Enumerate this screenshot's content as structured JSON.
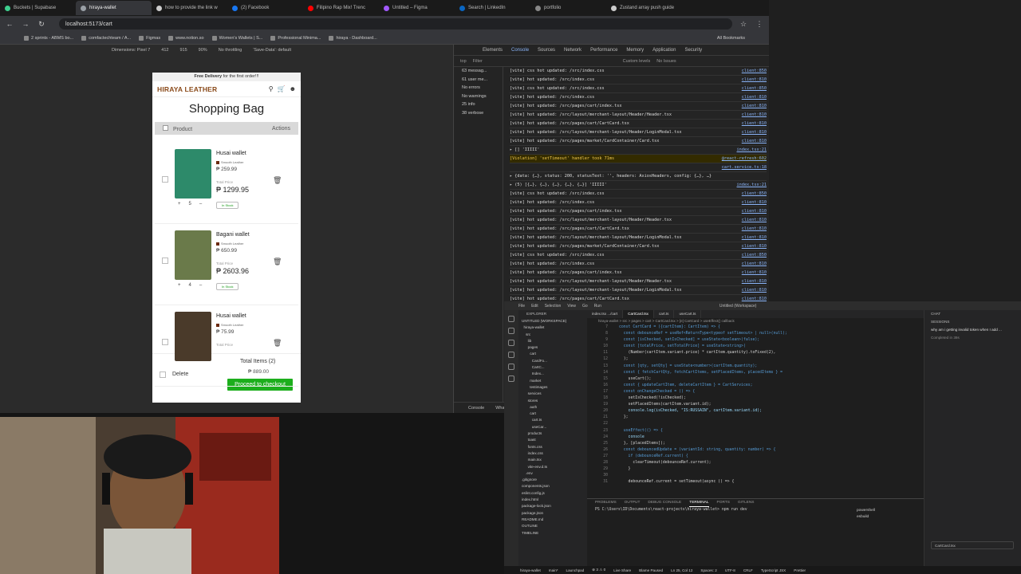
{
  "browser": {
    "tabs": [
      {
        "label": "Buckets | Supabase",
        "color": "#3ecf8e",
        "active": false
      },
      {
        "label": "hiraya-wallet",
        "color": "#9aa0a6",
        "active": true
      },
      {
        "label": "how to provide the link w",
        "color": "#cccccc",
        "active": false
      },
      {
        "label": "(2) Facebook",
        "color": "#1877f2",
        "active": false
      },
      {
        "label": "Filipino Rap Mix! Trenc",
        "color": "#ff0000",
        "active": false
      },
      {
        "label": "Untitled – Figma",
        "color": "#a259ff",
        "active": false
      },
      {
        "label": "Search | LinkedIn",
        "color": "#0a66c2",
        "active": false
      },
      {
        "label": "portfolio",
        "color": "#888888",
        "active": false
      },
      {
        "label": "Zustand array push guide",
        "color": "#cccccc",
        "active": false
      }
    ],
    "url": "localhost:5173/cart",
    "bookmarks": [
      "2 sprints - ABMS bo...",
      "comfactechteam / A...",
      "Figmas",
      "www.notion.so",
      "Women's Wallets | S...",
      "Professional Minima...",
      "hiraya - Dashboard..."
    ],
    "all_bookmarks": "All Bookmarks",
    "device_toolbar": {
      "dimensions": "Dimensions: Pixel 7",
      "w": "412",
      "h": "915",
      "zoom": "90%",
      "throttle": "No throttling",
      "savedata": "'Save-Data': default"
    }
  },
  "shop": {
    "promo_bold": "Free Delivery",
    "promo_rest": " for the first order!!!",
    "logo": "HIRAYA LEATHER",
    "title": "Shopping Bag",
    "col_product": "Product",
    "col_actions": "Actions",
    "items": [
      {
        "name": "Husai wallet",
        "material": "Smooth Leather",
        "price": "₱ 259.99",
        "total_label": "Total Price",
        "total": "₱ 1299.95",
        "qty": "5",
        "stock": "In Stock",
        "img": "#2d8a6a"
      },
      {
        "name": "Bagani wallet",
        "material": "Smooth Leather",
        "price": "₱ 650.99",
        "total_label": "Total Price",
        "total": "₱ 2603.96",
        "qty": "4",
        "stock": "In Stock",
        "img": "#6a7a4a"
      },
      {
        "name": "Husai wallet",
        "material": "Smooth Leather",
        "price": "₱ 75.99",
        "total_label": "Total Price",
        "total": "",
        "qty": "",
        "stock": "",
        "img": "#4a3a2a"
      }
    ],
    "delete_label": "Delete",
    "total_items": "Total Items (2)",
    "total_price": "₱ 889.00",
    "checkout": "Proceed to checkout"
  },
  "devtools": {
    "tabs": [
      "Elements",
      "Console",
      "Sources",
      "Network",
      "Performance",
      "Memory",
      "Application",
      "Security"
    ],
    "filter_placeholder": "Filter",
    "context": "top",
    "levels": "Custom levels",
    "issues": "No Issues",
    "sidebar": [
      "63 messag...",
      "61 user me...",
      "No errors",
      "No warnings",
      "25 info",
      "38 verbose"
    ],
    "logs": [
      [
        "[vite] css hot updated: /src/index.css",
        "client:850"
      ],
      [
        "[vite] hot updated: /src/index.css",
        "client:810"
      ],
      [
        "[vite] css hot updated: /src/index.css",
        "client:850"
      ],
      [
        "[vite] hot updated: /src/index.css",
        "client:810"
      ],
      [
        "[vite] hot updated: /src/pages/cart/index.tsx",
        "client:810"
      ],
      [
        "[vite] hot updated: /src/layout/merchant-layout/Header/Header.tsx",
        "client:810"
      ],
      [
        "[vite] hot updated: /src/pages/cart/CartCard.tsx",
        "client:810"
      ],
      [
        "[vite] hot updated: /src/layout/merchant-layout/Header/LoginModal.tsx",
        "client:810"
      ],
      [
        "[vite] hot updated: /src/pages/market/CardContainer/Card.tsx",
        "client:810"
      ],
      [
        "▸ [] 'IIIII'",
        "index.tsx:21"
      ],
      [
        "[Violation] 'setTimeout' handler took 71ms",
        "@react-refresh:602"
      ],
      [
        "",
        "cart.service.ts:18"
      ],
      [
        "▸ {data: {…}, status: 200, statusText: '', headers: AxiosHeaders, config: {…}, …}",
        ""
      ],
      [
        "▸ (5) [{…}, {…}, {…}, {…}, {…}] 'IIIII'",
        "index.tsx:21"
      ],
      [
        "[vite] css hot updated: /src/index.css",
        "client:850"
      ],
      [
        "[vite] hot updated: /src/index.css",
        "client:810"
      ],
      [
        "[vite] hot updated: /src/pages/cart/index.tsx",
        "client:810"
      ],
      [
        "[vite] hot updated: /src/layout/merchant-layout/Header/Header.tsx",
        "client:810"
      ],
      [
        "[vite] hot updated: /src/pages/cart/CartCard.tsx",
        "client:810"
      ],
      [
        "[vite] hot updated: /src/layout/merchant-layout/Header/LoginModal.tsx",
        "client:810"
      ],
      [
        "[vite] hot updated: /src/pages/market/CardContainer/Card.tsx",
        "client:810"
      ],
      [
        "[vite] css hot updated: /src/index.css",
        "client:850"
      ],
      [
        "[vite] hot updated: /src/index.css",
        "client:810"
      ],
      [
        "[vite] hot updated: /src/pages/cart/index.tsx",
        "client:810"
      ],
      [
        "[vite] hot updated: /src/layout/merchant-layout/Header/Header.tsx",
        "client:810"
      ],
      [
        "[vite] hot updated: /src/layout/merchant-layout/Header/LoginModal.tsx",
        "client:810"
      ],
      [
        "[vite] hot updated: /src/pages/cart/CartCard.tsx",
        "client:810"
      ]
    ],
    "bottom_tabs": [
      "Console",
      "What's New"
    ]
  },
  "vscode": {
    "menu": [
      "File",
      "Edit",
      "Selection",
      "View",
      "Go",
      "Run"
    ],
    "title": "Untitled (Workspace)",
    "tabs": [
      "index.tsx .../cart",
      "CartCard.tsx",
      "cart.ts",
      "useCart.ts"
    ],
    "breadcrumb": "hiraya-wallet > src > pages > cart > CartCard.tsx > [e] CartCard > useEffect() callback",
    "explorer_header": "EXPLORER",
    "explorer": [
      "UNTITLED (WORKSPACE)",
      "  hiraya-wallet",
      "    src",
      "      lib",
      "      pages",
      "        cart",
      "          CardFo...",
      "          CartC...",
      "          Index...",
      "        market",
      "        testimages",
      "      services",
      "      stores",
      "        auth",
      "        cart",
      "          cart.ts",
      "          useCar...",
      "      products",
      "      toast",
      "      fonts.css",
      "      index.css",
      "      main.tsx",
      "      vite-env.d.ts",
      "    .env",
      ".gitignore",
      "components.json",
      "eslint.config.js",
      "index.html",
      "package-lock.json",
      "package.json",
      "README.md",
      "OUTLINE",
      "TIMELINE"
    ],
    "code": [
      [
        "7",
        "const CartCard = ({cartItem}: CartItem) => {"
      ],
      [
        "8",
        "  const debounceRef = useRef<ReturnType<typeof setTimeout> | null>(null);"
      ],
      [
        "9",
        "  const [isChecked, setIsChecked] = useState<boolean>(false);"
      ],
      [
        "10",
        "  const [totalPrice, setTotalPrice] = useState<string>("
      ],
      [
        "11",
        "    (Number(cartItem.variant.price) * cartItem.quantity).toFixed(2),"
      ],
      [
        "12",
        "  );"
      ],
      [
        "13",
        "  const [qty, setQty] = useState<number>(cartItem.quantity);"
      ],
      [
        "14",
        "  const { fetchCartQty, fetchCartItems, setPlacedItems, placedItems } ="
      ],
      [
        "15",
        "    useCart();"
      ],
      [
        "16",
        "  const { updateCartItem, deleteCartItem } = CartServices;"
      ],
      [
        "17",
        "  const onChangeChecked = () => {"
      ],
      [
        "18",
        "    setIsChecked(!isChecked);"
      ],
      [
        "19",
        "    setPlacedItems(cartItem.variant.id);"
      ],
      [
        "20",
        "    console.log(isChecked, \"IS:RUSSAIN\", cartItem.variant.id);"
      ],
      [
        "21",
        "  };"
      ],
      [
        "22",
        ""
      ],
      [
        "23",
        "  useEffect(() => {"
      ],
      [
        "24",
        "    console"
      ],
      [
        "25",
        "  }, [placedItems]);"
      ],
      [
        "26",
        "  const debouncedUpdate = (variantId: string, quantity: number) => {"
      ],
      [
        "27",
        "    if (debounceRef.current) {"
      ],
      [
        "28",
        "      clearTimeout(debounceRef.current);"
      ],
      [
        "29",
        "    }"
      ],
      [
        "30",
        ""
      ],
      [
        "31",
        "    debounceRef.current = setTimeout(async () => {"
      ]
    ],
    "terminal_tabs": [
      "PROBLEMS",
      "OUTPUT",
      "DEBUG CONSOLE",
      "TERMINAL",
      "PORTS",
      "GITLENS"
    ],
    "terminal_lines": [
      "PS C:\\Users\\ID\\Documents\\react-projects\\hiraya-wallet> npm run dev"
    ],
    "terminal_shells": [
      "powershell",
      "esbuild"
    ],
    "chat_header": "CHAT",
    "chat_sessions": "SESSIONS",
    "chat_msg": "why am i getting invalid token when I add ...",
    "chat_sub": "Completed in 39s",
    "chat_input": "CartCard.tsx",
    "status": [
      "hiraya-wallet",
      "main*",
      "Launchpad",
      "⊗ 3 ⚠ 0",
      "Live Share",
      "Blame Paused",
      "Ln 25, Col 12",
      "Spaces: 2",
      "UTF-8",
      "CRLF",
      "TypeScript JSX",
      "Prettier"
    ]
  }
}
